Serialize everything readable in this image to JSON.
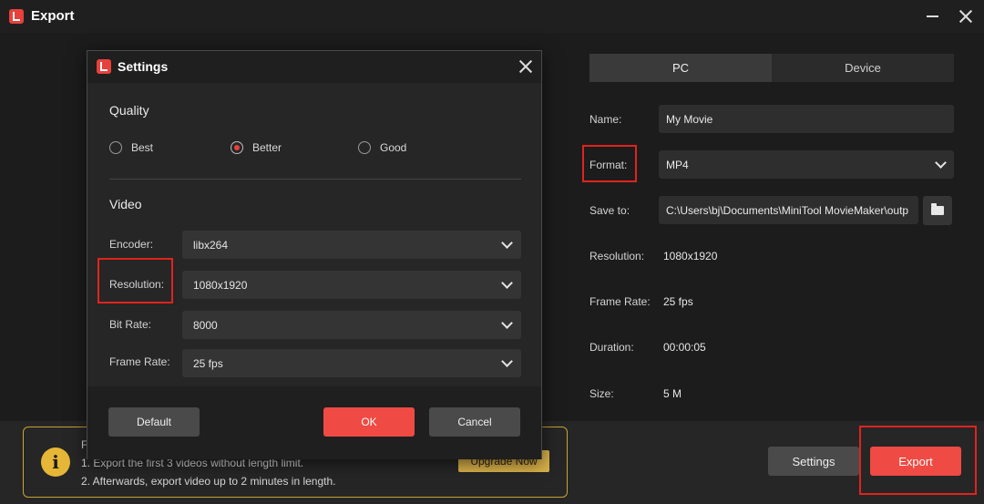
{
  "window": {
    "title": "Export"
  },
  "tabs": [
    {
      "label": "PC"
    },
    {
      "label": "Device"
    }
  ],
  "export_panel": {
    "name": {
      "label": "Name:",
      "value": "My Movie"
    },
    "format": {
      "label": "Format:",
      "value": "MP4"
    },
    "save_to": {
      "label": "Save to:",
      "value": "C:\\Users\\bj\\Documents\\MiniTool MovieMaker\\outp"
    },
    "resolution": {
      "label": "Resolution:",
      "value": "1080x1920"
    },
    "frame_rate": {
      "label": "Frame Rate:",
      "value": "25 fps"
    },
    "duration": {
      "label": "Duration:",
      "value": "00:00:05"
    },
    "size": {
      "label": "Size:",
      "value": "5 M"
    }
  },
  "notice": {
    "heading": "F",
    "lines": [
      "1. Export the first 3 videos without length limit.",
      "2. Afterwards, export video up to 2 minutes in length."
    ],
    "upgrade_label": "Upgrade Now"
  },
  "footer": {
    "settings_label": "Settings",
    "export_label": "Export"
  },
  "settings_dialog": {
    "title": "Settings",
    "quality": {
      "heading": "Quality",
      "options": [
        {
          "label": "Best"
        },
        {
          "label": "Better"
        },
        {
          "label": "Good"
        }
      ],
      "selected": "Better"
    },
    "video": {
      "heading": "Video",
      "encoder": {
        "label": "Encoder:",
        "value": "libx264"
      },
      "resolution": {
        "label": "Resolution:",
        "value": "1080x1920"
      },
      "bit_rate": {
        "label": "Bit Rate:",
        "value": "8000"
      },
      "frame_rate": {
        "label": "Frame Rate:",
        "value": "25 fps"
      }
    },
    "buttons": {
      "default": "Default",
      "ok": "OK",
      "cancel": "Cancel"
    }
  },
  "colors": {
    "accent": "#ef4a43",
    "highlight_border": "#e0231e",
    "notice_border": "#c9a232",
    "info_icon": "#e6b637",
    "background": "#1c1c1c"
  },
  "icons": [
    "app-logo-icon",
    "minimize-icon",
    "close-icon",
    "chevron-down-icon",
    "folder-icon",
    "info-icon"
  ]
}
